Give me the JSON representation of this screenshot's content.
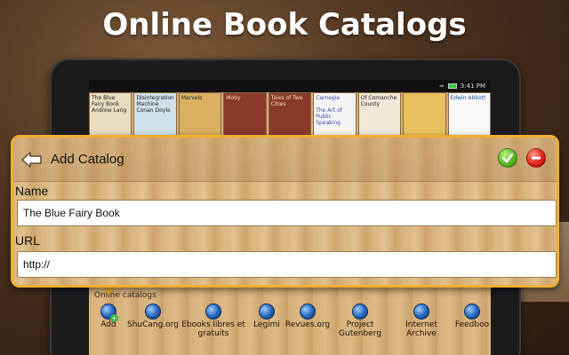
{
  "headline": "Online Book Catalogs",
  "status_bar": {
    "time": "3:41 PM"
  },
  "book_covers": [
    {
      "title": "The Blue Fairy Book",
      "author": "Andrew Lang"
    },
    {
      "title": "Disintegration Machine",
      "author": "Conan Doyle"
    },
    {
      "title": "Marvels"
    },
    {
      "title": "Moby"
    },
    {
      "title": "Tales of Two Cities"
    },
    {
      "title": "The Art of Public Speaking",
      "author": "Carnegie"
    },
    {
      "title": "Of Comanche County"
    },
    {
      "title": ""
    },
    {
      "title": "Edwin Abbott"
    }
  ],
  "dialog": {
    "title": "Add Catalog",
    "name_label": "Name",
    "name_value": "The Blue Fairy Book",
    "url_label": "URL",
    "url_value": "http://"
  },
  "catalogs": {
    "section_label": "Online catalogs",
    "items": [
      {
        "label": "Add",
        "icon": "globe-add-icon"
      },
      {
        "label": "ShuCang.org",
        "icon": "globe-icon"
      },
      {
        "label": "Ebooks libres et gratuits",
        "icon": "globe-icon"
      },
      {
        "label": "Legimi",
        "icon": "globe-icon"
      },
      {
        "label": "Revues.org",
        "icon": "globe-icon"
      },
      {
        "label": "Project Gutenberg",
        "icon": "globe-icon"
      },
      {
        "label": "Internet Archive",
        "icon": "globe-icon"
      },
      {
        "label": "Feedboo",
        "icon": "globe-icon"
      }
    ]
  },
  "colors": {
    "dialog_border": "#f0b030",
    "ok_button": "#5cb82a",
    "cancel_button": "#e0241c"
  }
}
